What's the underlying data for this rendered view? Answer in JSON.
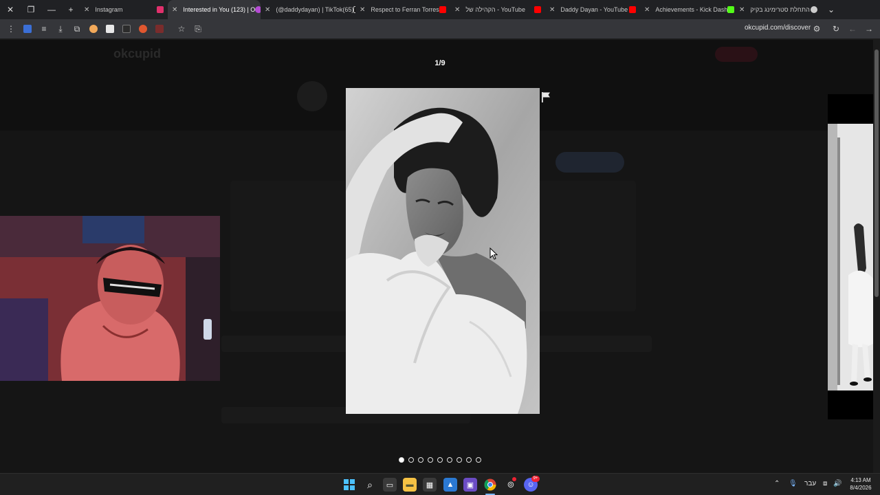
{
  "browser": {
    "tabs": [
      {
        "title": "Instagram",
        "favicon_color": "#e1306c"
      },
      {
        "title": "Interested in You (123) | O",
        "favicon_color": "#b54bd4"
      },
      {
        "title": "(@daddydayan) | TikTok(65)",
        "favicon_color": "#111111"
      },
      {
        "title": "Respect to Ferran Torres",
        "favicon_color": "#ff0000"
      },
      {
        "title": "הקהילה של - YouTube",
        "favicon_color": "#ff0000"
      },
      {
        "title": "Daddy Dayan - YouTube",
        "favicon_color": "#ff0000"
      },
      {
        "title": "Achievements - Kick Dash",
        "favicon_color": "#53fc18"
      },
      {
        "title": "התחלת סטרימינג בקיק",
        "favicon_color": "#cccccc"
      }
    ],
    "url": "okcupid.com/discover"
  },
  "background_page": {
    "logo": "okcupid"
  },
  "viewer": {
    "counter": "1/9",
    "dot_count": 9,
    "active_dot": 0
  },
  "taskbar": {
    "language": "עבר",
    "time": "4:13 AM",
    "date": "8/4/2026",
    "discord_badge": "9+"
  }
}
